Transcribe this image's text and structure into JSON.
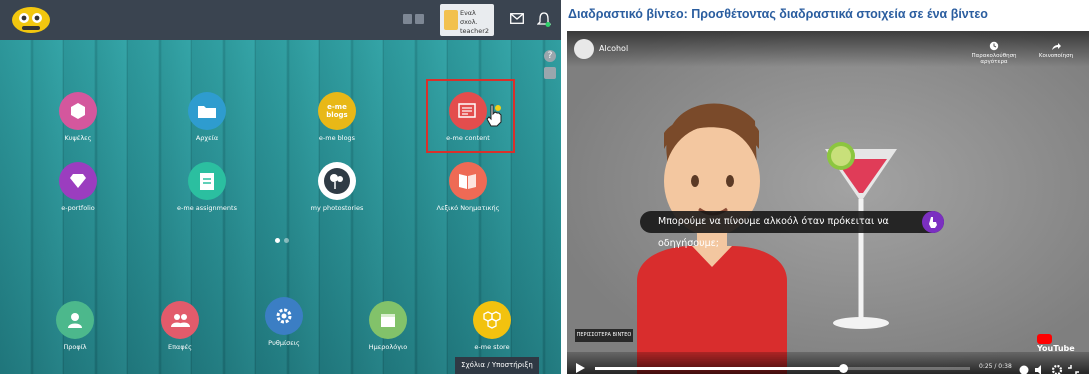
{
  "left_app": {
    "user": {
      "name": "Εναλ σxoλ. teacher2"
    },
    "lang_buttons": [
      "",
      ""
    ],
    "help": "?",
    "tiles": [
      {
        "label": "Κυψέλες",
        "color": "#d4579d",
        "icon": "hexagon-icon"
      },
      {
        "label": "Αρχεία",
        "color": "#2e9ccf",
        "icon": "folder-icon"
      },
      {
        "label": "e-me blogs",
        "badge": "e-me blogs",
        "color": "#e8b817",
        "icon": "blogs-icon"
      },
      {
        "label": "e-me content",
        "color": "#e34d4d",
        "icon": "content-icon"
      },
      {
        "label": "e-portfolio",
        "color": "#9b3dbf",
        "icon": "diamond-icon"
      },
      {
        "label": "e-me assignments",
        "color": "#2bbfa0",
        "icon": "assignments-icon"
      },
      {
        "label": "my photostories",
        "color": "#2f3b45",
        "icon": "photostories-icon"
      },
      {
        "label": "Λεξικό Νοηματικής",
        "color": "#ee6a55",
        "icon": "dictionary-icon"
      }
    ],
    "dock": [
      {
        "label": "Προφίλ",
        "color": "#4cb88c",
        "icon": "user-icon"
      },
      {
        "label": "Επαφές",
        "color": "#e25b6b",
        "icon": "contacts-icon"
      },
      {
        "label": "Ρυθμίσεις",
        "color": "#3b7ec4",
        "icon": "gear-icon"
      },
      {
        "label": "Ημερολόγιο",
        "color": "#82c26a",
        "icon": "calendar-icon"
      },
      {
        "label": "e-me store",
        "color": "#f2c20f",
        "icon": "store-icon"
      }
    ],
    "support_button": "Σχόλια / Υποστήριξη",
    "colors": {
      "topbar": "#3a4450",
      "highlight": "#d9302b",
      "accent_dot": "#ffffff"
    }
  },
  "right_video": {
    "page_title": "Διαδραστικό βίντεο: Προσθέτοντας διαδραστικά στοιχεία σε ένα βίντεο",
    "video_name": "Alcohol",
    "watch_later": "Παρακολούθηση αργότερα",
    "share": "Κοινοποίηση",
    "caption": "Μπορούμε να πίνουμε αλκοόλ όταν πρόκειται να οδηγήσουμε;",
    "more_videos": "ΠΕΡΙΣΣΟΤΕΡΑ ΒΙΝΤΕΟ",
    "time": "0:25 / 0:38",
    "progress": 0.66,
    "brand": "YouTube",
    "colors": {
      "title": "#2a5d9f",
      "caption_button": "#7b2fc1",
      "youtube_red": "#ff0000"
    }
  }
}
